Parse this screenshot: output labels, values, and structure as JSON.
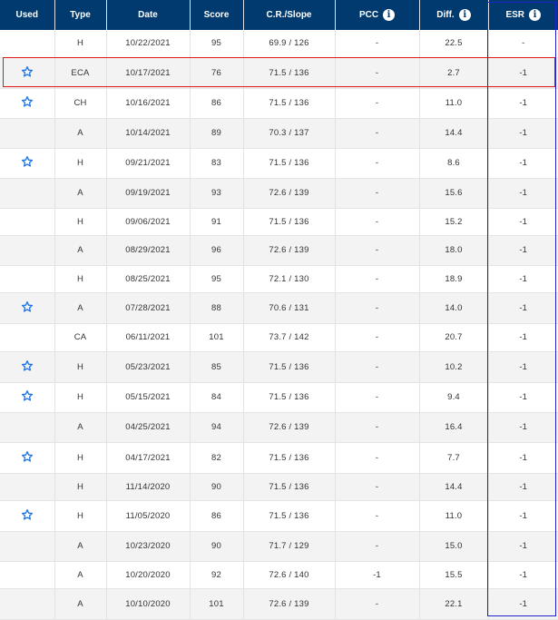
{
  "headers": {
    "used": "Used",
    "type": "Type",
    "date": "Date",
    "score": "Score",
    "cr_slope": "C.R./Slope",
    "pcc": "PCC",
    "diff": "Diff.",
    "esr": "ESR"
  },
  "info_glyph": "i",
  "colors": {
    "header_bg": "#003a6e",
    "star": "#1a73e8",
    "highlight_row_border": "#e01818",
    "highlight_col_border": "#2222cc"
  },
  "rows": [
    {
      "used": false,
      "type": "H",
      "date": "10/22/2021",
      "score": "95",
      "cr": "69.9 / 126",
      "pcc": "-",
      "diff": "22.5",
      "esr": "-"
    },
    {
      "used": true,
      "type": "ECA",
      "date": "10/17/2021",
      "score": "76",
      "cr": "71.5 / 136",
      "pcc": "-",
      "diff": "2.7",
      "esr": "-1"
    },
    {
      "used": true,
      "type": "CH",
      "date": "10/16/2021",
      "score": "86",
      "cr": "71.5 / 136",
      "pcc": "-",
      "diff": "11.0",
      "esr": "-1"
    },
    {
      "used": false,
      "type": "A",
      "date": "10/14/2021",
      "score": "89",
      "cr": "70.3 / 137",
      "pcc": "-",
      "diff": "14.4",
      "esr": "-1"
    },
    {
      "used": true,
      "type": "H",
      "date": "09/21/2021",
      "score": "83",
      "cr": "71.5 / 136",
      "pcc": "-",
      "diff": "8.6",
      "esr": "-1"
    },
    {
      "used": false,
      "type": "A",
      "date": "09/19/2021",
      "score": "93",
      "cr": "72.6 / 139",
      "pcc": "-",
      "diff": "15.6",
      "esr": "-1"
    },
    {
      "used": false,
      "type": "H",
      "date": "09/06/2021",
      "score": "91",
      "cr": "71.5 / 136",
      "pcc": "-",
      "diff": "15.2",
      "esr": "-1"
    },
    {
      "used": false,
      "type": "A",
      "date": "08/29/2021",
      "score": "96",
      "cr": "72.6 / 139",
      "pcc": "-",
      "diff": "18.0",
      "esr": "-1"
    },
    {
      "used": false,
      "type": "H",
      "date": "08/25/2021",
      "score": "95",
      "cr": "72.1 / 130",
      "pcc": "-",
      "diff": "18.9",
      "esr": "-1"
    },
    {
      "used": true,
      "type": "A",
      "date": "07/28/2021",
      "score": "88",
      "cr": "70.6 / 131",
      "pcc": "-",
      "diff": "14.0",
      "esr": "-1"
    },
    {
      "used": false,
      "type": "CA",
      "date": "06/11/2021",
      "score": "101",
      "cr": "73.7 / 142",
      "pcc": "-",
      "diff": "20.7",
      "esr": "-1"
    },
    {
      "used": true,
      "type": "H",
      "date": "05/23/2021",
      "score": "85",
      "cr": "71.5 / 136",
      "pcc": "-",
      "diff": "10.2",
      "esr": "-1"
    },
    {
      "used": true,
      "type": "H",
      "date": "05/15/2021",
      "score": "84",
      "cr": "71.5 / 136",
      "pcc": "-",
      "diff": "9.4",
      "esr": "-1"
    },
    {
      "used": false,
      "type": "A",
      "date": "04/25/2021",
      "score": "94",
      "cr": "72.6 / 139",
      "pcc": "-",
      "diff": "16.4",
      "esr": "-1"
    },
    {
      "used": true,
      "type": "H",
      "date": "04/17/2021",
      "score": "82",
      "cr": "71.5 / 136",
      "pcc": "-",
      "diff": "7.7",
      "esr": "-1"
    },
    {
      "used": false,
      "type": "H",
      "date": "11/14/2020",
      "score": "90",
      "cr": "71.5 / 136",
      "pcc": "-",
      "diff": "14.4",
      "esr": "-1"
    },
    {
      "used": true,
      "type": "H",
      "date": "11/05/2020",
      "score": "86",
      "cr": "71.5 / 136",
      "pcc": "-",
      "diff": "11.0",
      "esr": "-1"
    },
    {
      "used": false,
      "type": "A",
      "date": "10/23/2020",
      "score": "90",
      "cr": "71.7 / 129",
      "pcc": "-",
      "diff": "15.0",
      "esr": "-1"
    },
    {
      "used": false,
      "type": "A",
      "date": "10/20/2020",
      "score": "92",
      "cr": "72.6 / 140",
      "pcc": "-1",
      "diff": "15.5",
      "esr": "-1"
    },
    {
      "used": false,
      "type": "A",
      "date": "10/10/2020",
      "score": "101",
      "cr": "72.6 / 139",
      "pcc": "-",
      "diff": "22.1",
      "esr": "-1"
    }
  ]
}
